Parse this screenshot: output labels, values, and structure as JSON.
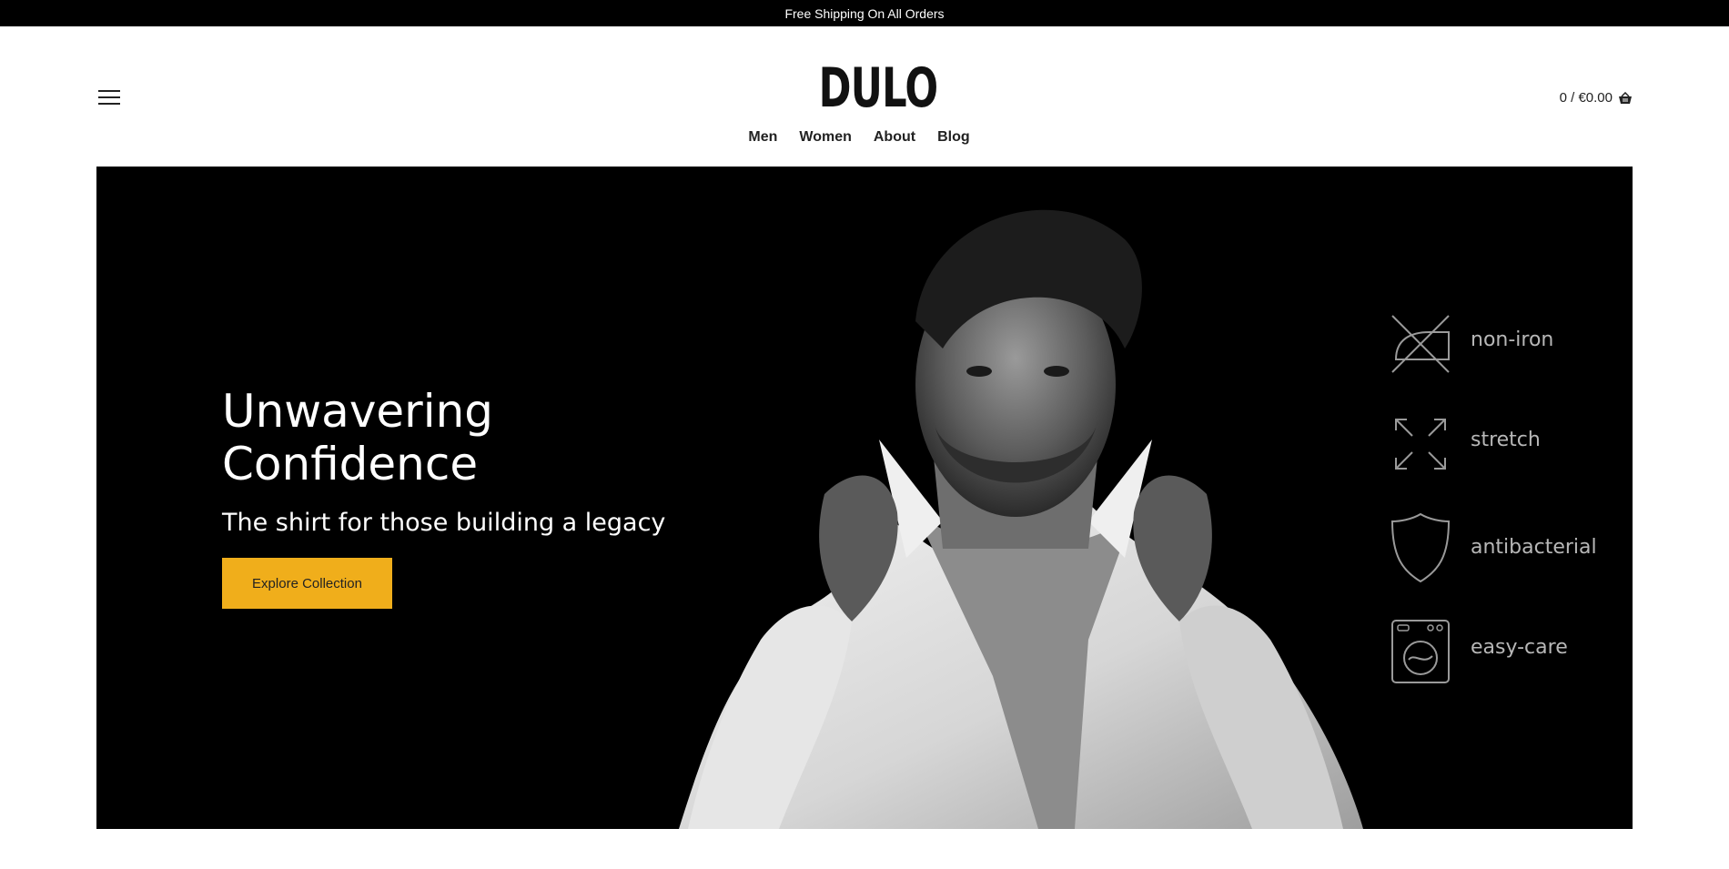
{
  "announcement": {
    "text": "Free Shipping On All Orders"
  },
  "header": {
    "logo_text": "DULO",
    "cart_text": "0 / €0.00",
    "nav": [
      "Men",
      "Women",
      "About",
      "Blog"
    ]
  },
  "hero": {
    "title_line1": "Unwavering",
    "title_line2": "Confidence",
    "subtitle": "The shirt for those building a legacy",
    "cta_label": "Explore Collection",
    "features": [
      {
        "label": "non-iron",
        "icon": "no-iron-icon"
      },
      {
        "label": "stretch",
        "icon": "stretch-arrows-icon"
      },
      {
        "label": "antibacterial",
        "icon": "shield-icon"
      },
      {
        "label": "easy-care",
        "icon": "washing-machine-icon"
      }
    ]
  },
  "colors": {
    "accent": "#f0ae1b",
    "hero_background": "#000000",
    "announcement_background": "#000000",
    "feature_text": "#b7b7b7"
  }
}
